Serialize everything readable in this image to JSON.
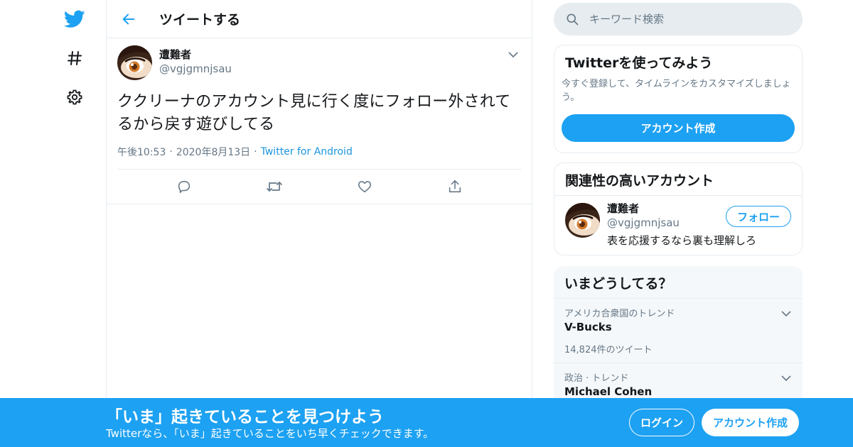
{
  "nav": {
    "icons": [
      "twitter-bird-icon",
      "hashtag-icon",
      "gear-icon"
    ]
  },
  "header": {
    "title": "ツイートする"
  },
  "tweet": {
    "author_name": "遭難者",
    "author_handle": "@vgjgmnjsau",
    "text": "ククリーナのアカウント見に行く度にフォロー外されてるから戻す遊びしてる",
    "time": "午後10:53",
    "date": "2020年8月13日",
    "separator": "·",
    "source": "Twitter for Android"
  },
  "search": {
    "placeholder": "キーワード検索"
  },
  "signup_card": {
    "title": "Twitterを使ってみよう",
    "description": "今すぐ登録して、タイムラインをカスタマイズしましょう。",
    "button": "アカウント作成"
  },
  "related_card": {
    "title": "関連性の高いアカウント",
    "user": {
      "name": "遭難者",
      "handle": "@vgjgmnjsau",
      "bio": "表を応援するなら裏も理解しろ",
      "follow_label": "フォロー"
    }
  },
  "trends_card": {
    "title": "いまどうしてる？",
    "items": [
      {
        "context": "アメリカ合衆国のトレンド",
        "name": "V-Bucks",
        "count": "14,824件のツイート"
      },
      {
        "context": "政治 · トレンド",
        "name": "Michael Cohen",
        "count": ""
      }
    ]
  },
  "banner": {
    "title": "「いま」起きていることを見つけよう",
    "subtitle": "Twitterなら、「いま」起きていることをいち早くチェックできます。",
    "login": "ログイン",
    "signup": "アカウント作成"
  },
  "colors": {
    "accent": "#1da1f2",
    "border": "#e6ecf0",
    "secondary_text": "#657786",
    "link": "#1b95e0"
  }
}
